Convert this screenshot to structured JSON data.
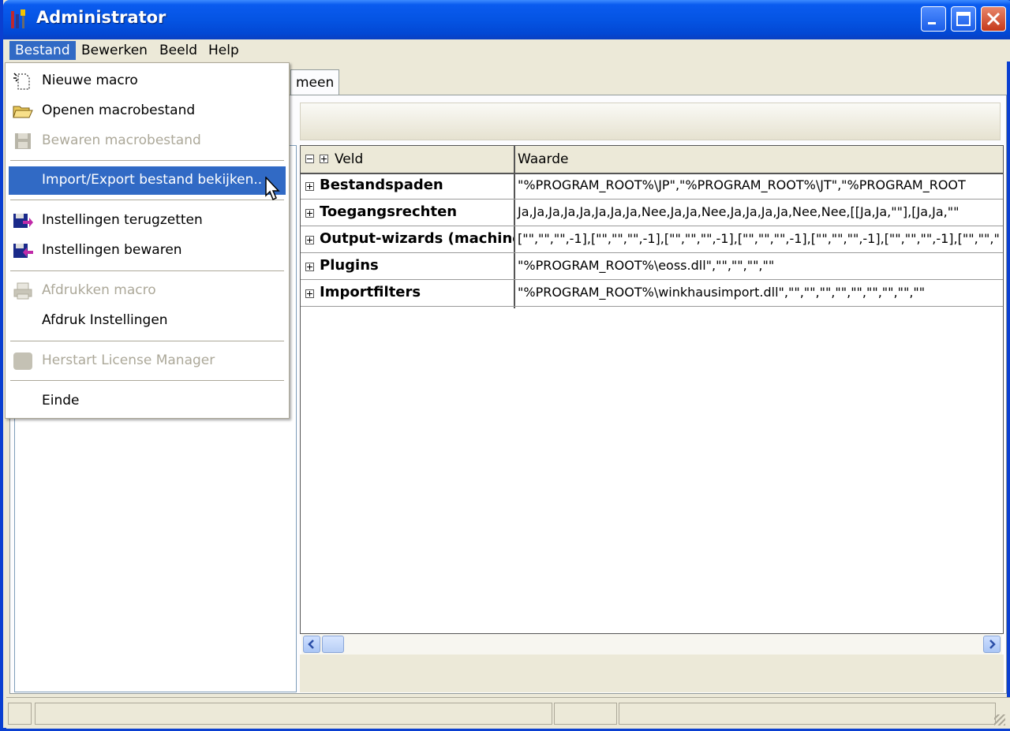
{
  "window": {
    "title": "Administrator"
  },
  "menubar": {
    "items": [
      "Bestand",
      "Bewerken",
      "Beeld",
      "Help"
    ]
  },
  "tab": {
    "label": "meen"
  },
  "grid": {
    "headers": {
      "field": "Veld",
      "value": "Waarde"
    },
    "rows": [
      {
        "name": "Bestandspaden",
        "value": "\"%PROGRAM_ROOT%\\JP\",\"%PROGRAM_ROOT%\\JT\",\"%PROGRAM_ROOT"
      },
      {
        "name": "Toegangsrechten",
        "value": "Ja,Ja,Ja,Ja,Ja,Ja,Ja,Ja,Nee,Ja,Ja,Nee,Ja,Ja,Ja,Ja,Nee,Nee,[[Ja,Ja,\"\"],[Ja,Ja,\"\""
      },
      {
        "name": "Output-wizards (machinest",
        "value": "[\"\",\"\",\"\",-1],[\"\",\"\",\"\",-1],[\"\",\"\",\"\",-1],[\"\",\"\",\"\",-1],[\"\",\"\",\"\",-1],[\"\",\"\",\"\",-1],[\"\",\"\",\""
      },
      {
        "name": "Plugins",
        "value": "\"%PROGRAM_ROOT%\\eoss.dll\",\"\",\"\",\"\",\"\""
      },
      {
        "name": "Importfilters",
        "value": "\"%PROGRAM_ROOT%\\winkhausimport.dll\",\"\",\"\",\"\",\"\",\"\",\"\",\"\",\"\",\"\""
      }
    ]
  },
  "dropdown": {
    "items": [
      {
        "label": "Nieuwe macro",
        "icon": "new-macro-icon",
        "disabled": false
      },
      {
        "label": "Openen macrobestand",
        "icon": "open-folder-icon",
        "disabled": false
      },
      {
        "label": "Bewaren macrobestand",
        "icon": "save-disk-icon",
        "disabled": true
      },
      {
        "label": "Import/Export bestand bekijken..",
        "icon": "",
        "disabled": false,
        "highlighted": true
      },
      {
        "label": "Instellingen terugzetten",
        "icon": "restore-settings-icon",
        "disabled": false
      },
      {
        "label": "Instellingen bewaren",
        "icon": "save-settings-icon",
        "disabled": false
      },
      {
        "label": "Afdrukken macro",
        "icon": "printer-icon",
        "disabled": true
      },
      {
        "label": "Afdruk Instellingen",
        "icon": "",
        "disabled": false
      },
      {
        "label": "Herstart License Manager",
        "icon": "license-manager-icon",
        "disabled": true
      },
      {
        "label": "Einde",
        "icon": "",
        "disabled": false
      }
    ]
  },
  "colors": {
    "titlebar": "#0554e3",
    "highlight": "#316ac5",
    "face": "#ece9d8"
  }
}
